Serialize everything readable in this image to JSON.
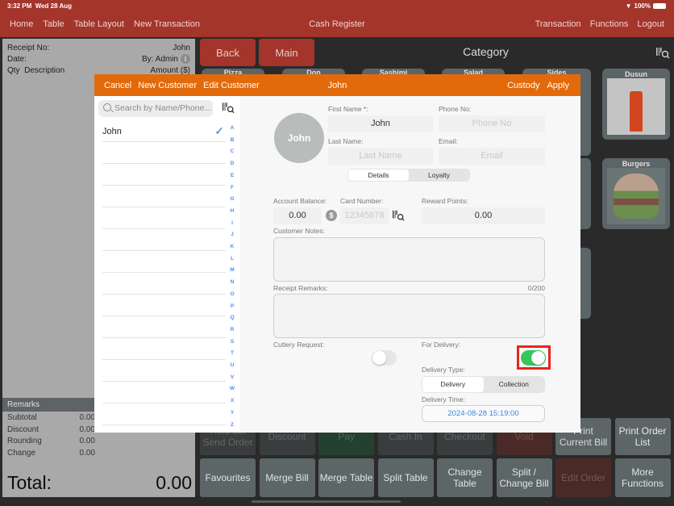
{
  "status_bar": {
    "time": "3:32 PM",
    "date": "Wed 28 Aug",
    "battery": "100%"
  },
  "nav": {
    "left": [
      "Home",
      "Table",
      "Table Layout",
      "New Transaction"
    ],
    "title": "Cash Register",
    "right": [
      "Transaction",
      "Functions",
      "Logout"
    ]
  },
  "receipt": {
    "receipt_no_label": "Receipt No:",
    "receipt_no_value": "John",
    "date_label": "Date:",
    "by_value": "By: Admin",
    "qty_label": "Qty",
    "desc_label": "Description",
    "amount_label": "Amount ($)",
    "remarks_label": "Remarks",
    "totals": [
      {
        "label": "Subtotal",
        "value": "0.00"
      },
      {
        "label": "Discount",
        "value": "0.00"
      },
      {
        "label": "Rounding",
        "value": "0.00"
      },
      {
        "label": "Change",
        "value": "0.00"
      }
    ],
    "total_label": "Total:",
    "total_value": "0.00"
  },
  "category": {
    "back_label": "Back",
    "main_label": "Main",
    "title": "Category",
    "tiles": [
      "Pizza",
      "Don",
      "Sashimi",
      "Salad",
      "Sides",
      "Dusun",
      "Burgers"
    ]
  },
  "function_buttons": {
    "row1": [
      "Hold Bill\nSend Order",
      "Discount",
      "Pay",
      "Cash In",
      "Checkout",
      "Void",
      "Print\nCurrent Bill",
      "Print Order\nList"
    ],
    "row2": [
      "Favourites",
      "Merge Bill",
      "Merge Table",
      "Split Table",
      "Change\nTable",
      "Split /\nChange Bill",
      "Edit Order",
      "More\nFunctions"
    ]
  },
  "modal": {
    "header": {
      "cancel": "Cancel",
      "new_customer": "New Customer",
      "edit_customer": "Edit Customer",
      "title": "John",
      "custody": "Custody",
      "apply": "Apply"
    },
    "search_placeholder": "Search by Name/Phone...",
    "customers": [
      {
        "name": "John",
        "selected": true
      }
    ],
    "alphabet": [
      "A",
      "B",
      "C",
      "D",
      "E",
      "F",
      "G",
      "H",
      "I",
      "J",
      "K",
      "L",
      "M",
      "N",
      "O",
      "P",
      "Q",
      "R",
      "S",
      "T",
      "U",
      "V",
      "W",
      "X",
      "Y",
      "Z"
    ],
    "avatar_text": "John",
    "first_name_label": "First Name *:",
    "first_name_value": "John",
    "phone_label": "Phone No:",
    "phone_placeholder": "Phone No",
    "last_name_label": "Last Name:",
    "last_name_placeholder": "Last Name",
    "email_label": "Email:",
    "email_placeholder": "Email",
    "tabs": [
      "Details",
      "Loyalty"
    ],
    "active_tab": "Details",
    "account_balance_label": "Account Balance:",
    "account_balance_value": "0.00",
    "card_number_label": "Card Number:",
    "card_number_placeholder": "12345678",
    "reward_points_label": "Reward Points:",
    "reward_points_value": "0.00",
    "customer_notes_label": "Customer Notes:",
    "customer_notes_value": "",
    "receipt_remarks_label": "Receipt Remarks:",
    "receipt_remarks_counter": "0/200",
    "receipt_remarks_value": "",
    "cutlery_label": "Cutlery Request:",
    "cutlery_on": false,
    "delivery_label": "For Delivery:",
    "delivery_on": true,
    "delivery_type_label": "Delivery Type:",
    "delivery_types": [
      "Delivery",
      "Collection"
    ],
    "delivery_type_selected": "Delivery",
    "delivery_time_label": "Delivery Time:",
    "delivery_time_value": "2024-08-28 15:19:00"
  },
  "colors": {
    "brand_red": "#a3352b",
    "modal_orange": "#e36a0a",
    "toggle_green": "#35c759",
    "highlight": "#e8241e",
    "link_blue": "#3a86e8"
  }
}
